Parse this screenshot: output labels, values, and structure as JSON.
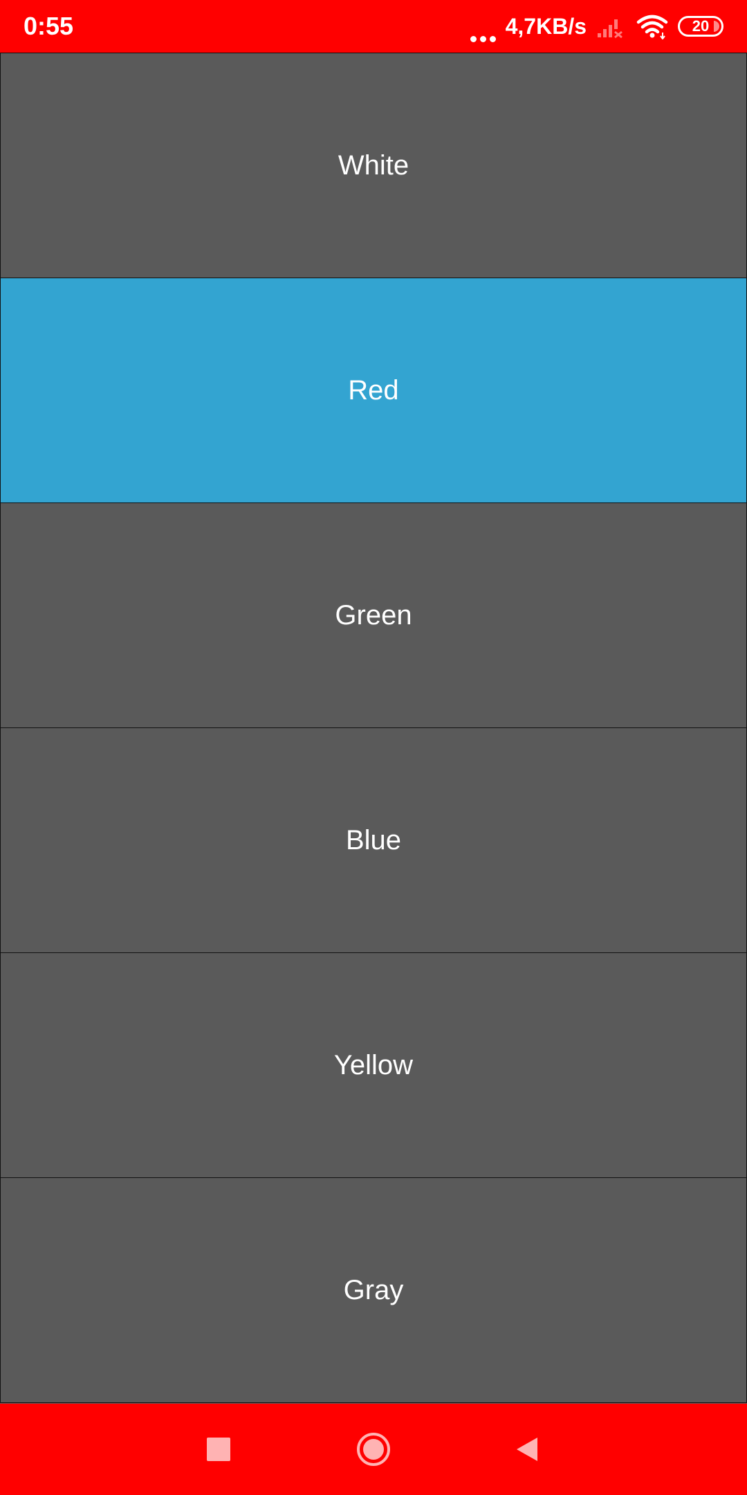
{
  "status_bar": {
    "time": "0:55",
    "network_speed": "4,7KB/s",
    "battery_level": "20",
    "icons": [
      "more-dots-icon",
      "signal-no-service-icon",
      "wifi-icon",
      "battery-icon"
    ]
  },
  "colors": {
    "accent": "#ff0000",
    "item_background": "#5a5a5a",
    "selected_background": "#33a4d1",
    "text": "#ffffff"
  },
  "list": {
    "selected_index": 1,
    "items": [
      {
        "label": "White"
      },
      {
        "label": "Red"
      },
      {
        "label": "Green"
      },
      {
        "label": "Blue"
      },
      {
        "label": "Yellow"
      },
      {
        "label": "Gray"
      }
    ]
  },
  "nav_bar": {
    "icons": [
      "recent-apps-icon",
      "home-icon",
      "back-icon"
    ]
  }
}
